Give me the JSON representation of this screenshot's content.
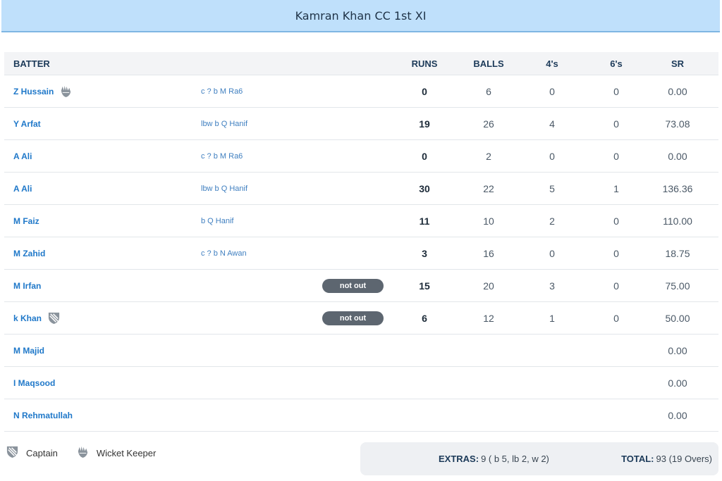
{
  "team": {
    "title": "Kamran Khan CC 1st XI"
  },
  "columns": {
    "batter": "BATTER",
    "runs": "RUNS",
    "balls": "BALLS",
    "fours": "4's",
    "sixes": "6's",
    "sr": "SR"
  },
  "batters": [
    {
      "name": "Z Hussain",
      "role": "wicket-keeper-icon",
      "dismissal": "c ? b M Ra6",
      "runs": "0",
      "balls": "6",
      "fours": "0",
      "sixes": "0",
      "sr": "0.00"
    },
    {
      "name": "Y Arfat",
      "role": "",
      "dismissal": "lbw b Q Hanif",
      "runs": "19",
      "balls": "26",
      "fours": "4",
      "sixes": "0",
      "sr": "73.08"
    },
    {
      "name": "A Ali",
      "role": "",
      "dismissal": "c ? b M Ra6",
      "runs": "0",
      "balls": "2",
      "fours": "0",
      "sixes": "0",
      "sr": "0.00"
    },
    {
      "name": "A Ali",
      "role": "",
      "dismissal": "lbw b Q Hanif",
      "runs": "30",
      "balls": "22",
      "fours": "5",
      "sixes": "1",
      "sr": "136.36"
    },
    {
      "name": "M Faiz",
      "role": "",
      "dismissal": "b Q Hanif",
      "runs": "11",
      "balls": "10",
      "fours": "2",
      "sixes": "0",
      "sr": "110.00"
    },
    {
      "name": "M Zahid",
      "role": "",
      "dismissal": "c ? b N Awan",
      "runs": "3",
      "balls": "16",
      "fours": "0",
      "sixes": "0",
      "sr": "18.75"
    },
    {
      "name": "M Irfan",
      "role": "",
      "dismissal": "not out",
      "runs": "15",
      "balls": "20",
      "fours": "3",
      "sixes": "0",
      "sr": "75.00"
    },
    {
      "name": "k Khan",
      "role": "captain-icon",
      "dismissal": "not out",
      "runs": "6",
      "balls": "12",
      "fours": "1",
      "sixes": "0",
      "sr": "50.00"
    },
    {
      "name": "M Majid",
      "role": "",
      "dismissal": "",
      "runs": "",
      "balls": "",
      "fours": "",
      "sixes": "",
      "sr": "0.00"
    },
    {
      "name": "I Maqsood",
      "role": "",
      "dismissal": "",
      "runs": "",
      "balls": "",
      "fours": "",
      "sixes": "",
      "sr": "0.00"
    },
    {
      "name": "N Rehmatullah",
      "role": "",
      "dismissal": "",
      "runs": "",
      "balls": "",
      "fours": "",
      "sixes": "",
      "sr": "0.00"
    }
  ],
  "legend": {
    "captain": "Captain",
    "wicket_keeper": "Wicket Keeper"
  },
  "summary": {
    "extras_label": "EXTRAS:",
    "extras_value": "9 ( b 5, lb 2, w 2)",
    "total_label": "TOTAL:",
    "total_value": "93 (19 Overs)"
  },
  "colors": {
    "header_bg": "#bfe0fb",
    "link_blue": "#1f78c9",
    "pill_bg": "#5d6670"
  }
}
